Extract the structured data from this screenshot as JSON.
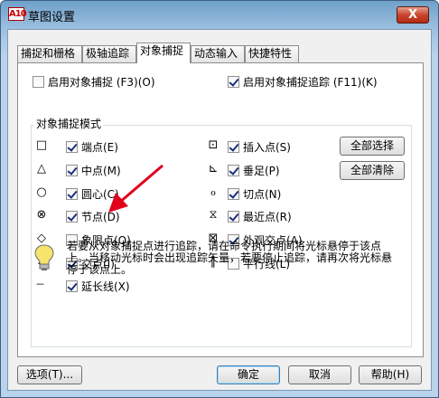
{
  "window": {
    "app_icon": "A10",
    "title": "草图设置",
    "close_label": "X"
  },
  "tabs": [
    {
      "label": "捕捉和栅格"
    },
    {
      "label": "极轴追踪"
    },
    {
      "label": "对象捕捉",
      "active": true
    },
    {
      "label": "动态输入"
    },
    {
      "label": "快捷特性"
    }
  ],
  "snap": {
    "enable_snap_label": "启用对象捕捉 (F3)(O)",
    "enable_snap_checked": false,
    "enable_tracking_label": "启用对象捕捉追踪 (F11)(K)",
    "enable_tracking_checked": true,
    "group_title": "对象捕捉模式",
    "left_modes": [
      {
        "symbol": "□",
        "label": "端点(E)",
        "checked": true
      },
      {
        "symbol": "△",
        "label": "中点(M)",
        "checked": true
      },
      {
        "symbol": "○",
        "label": "圆心(C)",
        "checked": true
      },
      {
        "symbol": "⊗",
        "label": "节点(D)",
        "checked": true
      },
      {
        "symbol": "◇",
        "label": "象限点(Q)",
        "checked": false
      },
      {
        "symbol": "✕",
        "label": "交点(I)",
        "checked": true
      },
      {
        "symbol": "---",
        "label": "延长线(X)",
        "checked": true
      }
    ],
    "right_modes": [
      {
        "symbol": "⊡",
        "label": "插入点(S)",
        "checked": true
      },
      {
        "symbol": "⊾",
        "label": "垂足(P)",
        "checked": true
      },
      {
        "symbol": "ℴ",
        "label": "切点(N)",
        "checked": true
      },
      {
        "symbol": "⧖",
        "label": "最近点(R)",
        "checked": true
      },
      {
        "symbol": "⊠",
        "label": "外观交点(A)",
        "checked": true
      },
      {
        "symbol": "∥",
        "label": "平行线(L)",
        "checked": false
      }
    ],
    "select_all_label": "全部选择",
    "clear_all_label": "全部清除",
    "info_text": "若要从对象捕捉点进行追踪，请在命令执行期间将光标悬停于该点上。当移动光标时会出现追踪矢量，若要停止追踪，请再次将光标悬停于该点上。"
  },
  "footer": {
    "options_label": "选项(T)...",
    "ok_label": "确定",
    "cancel_label": "取消",
    "help_label": "帮助(H)"
  },
  "colors": {
    "arrow": "#e0001b"
  }
}
